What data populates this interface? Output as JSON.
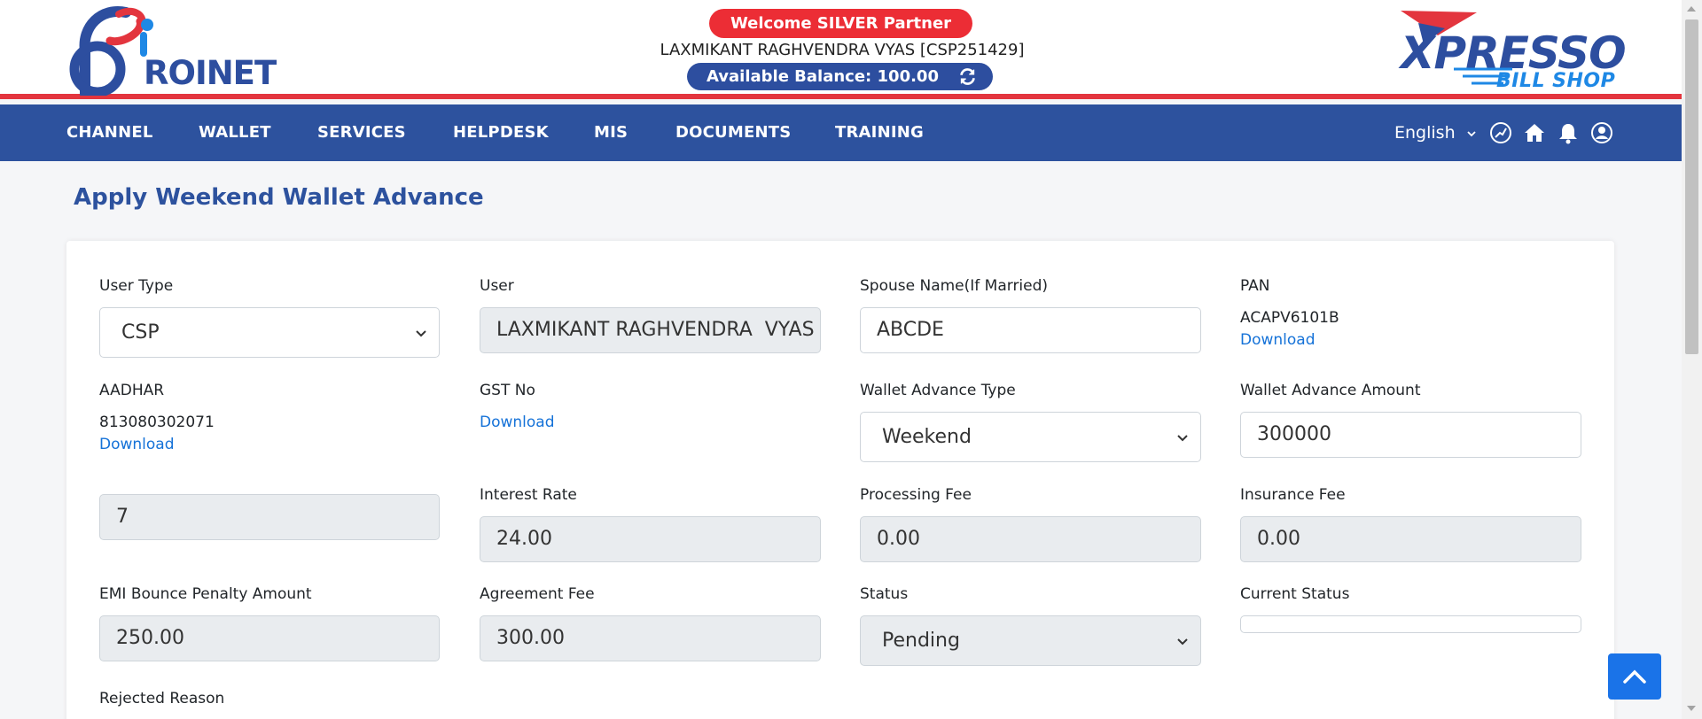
{
  "header": {
    "logo_left": "ROINET",
    "welcome": "Welcome SILVER Partner",
    "username": "LAXMIKANT RAGHVENDRA VYAS [CSP251429]",
    "balance": "Available Balance: 100.00",
    "logo_right_top": "XPRESSO",
    "logo_right_bottom": "BILL SHOP"
  },
  "nav": {
    "items": [
      "CHANNEL",
      "WALLET",
      "SERVICES",
      "HELPDESK",
      "MIS",
      "DOCUMENTS",
      "TRAINING"
    ],
    "language": "English",
    "icons": [
      "dashboard-icon",
      "home-icon",
      "bell-icon",
      "user-icon"
    ]
  },
  "page": {
    "title": "Apply Weekend Wallet Advance"
  },
  "form": {
    "user_type": {
      "label": "User Type",
      "value": "CSP"
    },
    "user": {
      "label": "User",
      "value": "LAXMIKANT RAGHVENDRA  VYAS"
    },
    "spouse": {
      "label": "Spouse Name(If Married)",
      "value": "ABCDE"
    },
    "pan": {
      "label": "PAN",
      "value": "ACAPV6101B",
      "link": "Download"
    },
    "aadhar": {
      "label": "AADHAR",
      "value": "813080302071",
      "link": "Download"
    },
    "gst": {
      "label": "GST No",
      "link": "Download"
    },
    "advance_type": {
      "label": "Wallet Advance Type",
      "value": "Weekend"
    },
    "advance_amount": {
      "label": "Wallet Advance Amount",
      "value": "300000"
    },
    "unlabeled": {
      "value": "7"
    },
    "interest_rate": {
      "label": "Interest Rate",
      "value": "24.00"
    },
    "processing_fee": {
      "label": "Processing Fee",
      "value": "0.00"
    },
    "insurance_fee": {
      "label": "Insurance Fee",
      "value": "0.00"
    },
    "emi_penalty": {
      "label": "EMI Bounce Penalty Amount",
      "value": "250.00"
    },
    "agreement_fee": {
      "label": "Agreement Fee",
      "value": "300.00"
    },
    "status": {
      "label": "Status",
      "value": "Pending"
    },
    "current_status": {
      "label": "Current Status",
      "value": ""
    },
    "rejected_reason": {
      "label": "Rejected Reason"
    }
  },
  "colors": {
    "brand_blue": "#2d529e",
    "brand_red": "#e3353e",
    "link": "#1572d8",
    "button": "#1a73e8"
  }
}
